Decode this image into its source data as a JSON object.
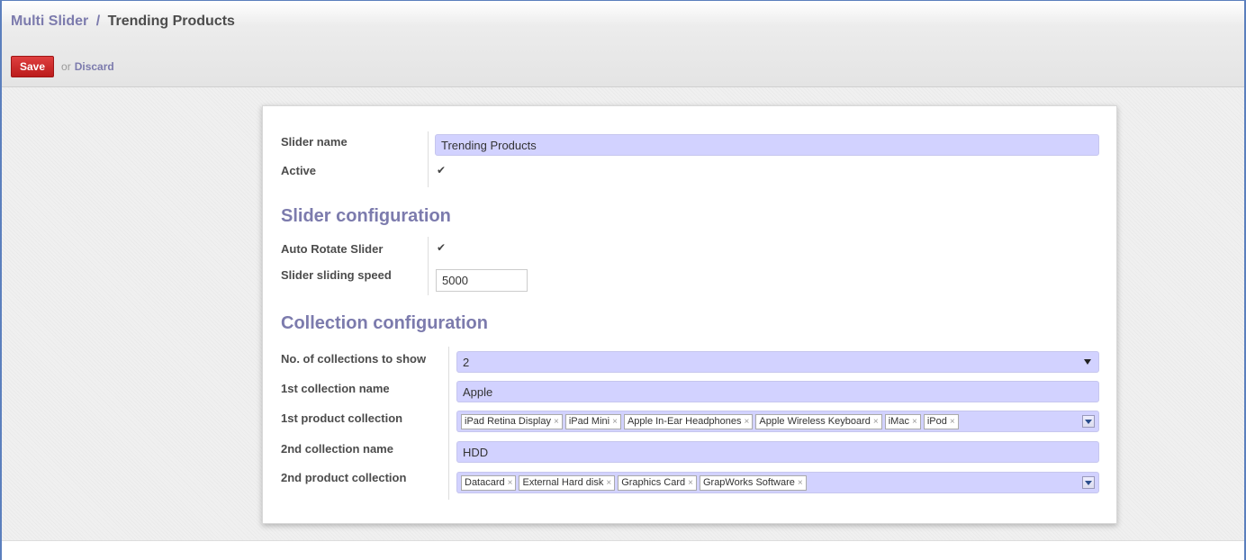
{
  "breadcrumb": {
    "parent": "Multi Slider",
    "separator": "/",
    "current": "Trending Products"
  },
  "actions": {
    "save_label": "Save",
    "or_text": "or",
    "discard_label": "Discard"
  },
  "form": {
    "slider_name_label": "Slider name",
    "slider_name_value": "Trending Products",
    "active_label": "Active",
    "active_checked": true,
    "slider_config_title": "Slider configuration",
    "auto_rotate_label": "Auto Rotate Slider",
    "auto_rotate_checked": true,
    "sliding_speed_label": "Slider sliding speed",
    "sliding_speed_value": "5000",
    "collection_config_title": "Collection configuration",
    "num_collections_label": "No. of collections to show",
    "num_collections_value": "2",
    "first_collection_name_label": "1st collection name",
    "first_collection_name_value": "Apple",
    "first_product_collection_label": "1st product collection",
    "first_product_collection_tags": [
      "iPad Retina Display",
      "iPad Mini",
      "Apple In-Ear Headphones",
      "Apple Wireless Keyboard",
      "iMac",
      "iPod"
    ],
    "second_collection_name_label": "2nd collection name",
    "second_collection_name_value": "HDD",
    "second_product_collection_label": "2nd product collection",
    "second_product_collection_tags": [
      "Datacard",
      "External Hard disk",
      "Graphics Card",
      "GrapWorks Software"
    ],
    "tag_remove_glyph": "×",
    "checkmark_glyph": "✔"
  },
  "colors": {
    "accent": "#7c7bad",
    "save_button": "#c62828",
    "field_bg": "#d2d2ff"
  }
}
